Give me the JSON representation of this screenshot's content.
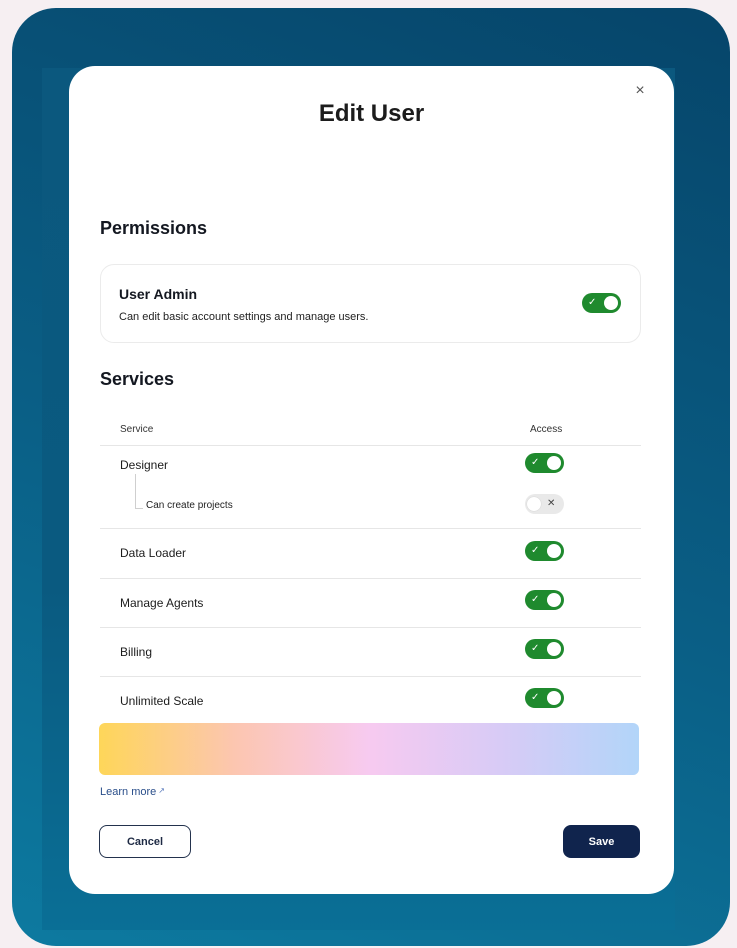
{
  "dialog": {
    "title": "Edit User",
    "close_label": "×"
  },
  "permissions": {
    "heading": "Permissions",
    "user_admin": {
      "name": "User Admin",
      "description": "Can edit basic account settings and manage users.",
      "enabled": true
    }
  },
  "services": {
    "heading": "Services",
    "columns": {
      "service": "Service",
      "access": "Access"
    },
    "rows": [
      {
        "label": "Designer",
        "enabled": true
      },
      {
        "label": "Can create projects",
        "enabled": false,
        "sub": true
      },
      {
        "label": "Data Loader",
        "enabled": true
      },
      {
        "label": "Manage Agents",
        "enabled": true
      },
      {
        "label": "Billing",
        "enabled": true
      },
      {
        "label": "Unlimited Scale",
        "enabled": true
      }
    ]
  },
  "toggle_marks": {
    "on": "✓",
    "off": "✕"
  },
  "learn_more": {
    "label": "Learn more",
    "icon": "external-link-icon",
    "glyph": "↗"
  },
  "footer": {
    "cancel_label": "Cancel",
    "save_label": "Save"
  },
  "colors": {
    "toggle_on": "#1f8a2e",
    "save_button": "#10244d",
    "frame": "#06456a"
  }
}
